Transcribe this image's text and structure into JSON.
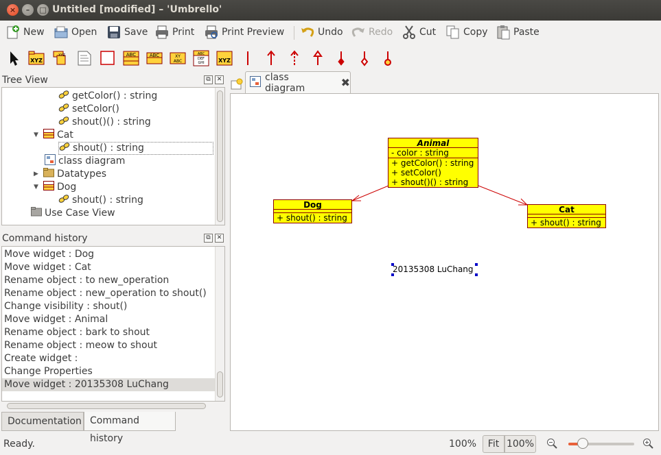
{
  "window": {
    "title": "Untitled [modified] – 'Umbrello'"
  },
  "toolbar": {
    "new": "New",
    "open": "Open",
    "save": "Save",
    "print": "Print",
    "print_preview": "Print Preview",
    "undo": "Undo",
    "redo": "Redo",
    "cut": "Cut",
    "copy": "Copy",
    "paste": "Paste"
  },
  "diagram_tools": [
    {
      "name": "select-tool-icon",
      "label": ""
    },
    {
      "name": "class-xyz-tool-icon",
      "label": "XYZ"
    },
    {
      "name": "package-tool-icon",
      "label": ""
    },
    {
      "name": "note-tool-icon",
      "label": ""
    },
    {
      "name": "box-tool-icon",
      "label": ""
    },
    {
      "name": "class-tool-icon",
      "label": "ABC"
    },
    {
      "name": "interface-tool-icon",
      "label": "ABC"
    },
    {
      "name": "datatype-tool-icon",
      "label": "XY ABC"
    },
    {
      "name": "enum-tool-icon",
      "label": "ABC DEF GHI"
    },
    {
      "name": "entity-tool-icon",
      "label": "XYZ"
    },
    {
      "name": "association-tool-icon",
      "label": ""
    },
    {
      "name": "directional-association-tool-icon",
      "label": ""
    },
    {
      "name": "dependency-tool-icon",
      "label": ""
    },
    {
      "name": "generalization-tool-icon",
      "label": ""
    },
    {
      "name": "aggregation-tool-icon",
      "label": ""
    },
    {
      "name": "composition-tool-icon",
      "label": ""
    },
    {
      "name": "containment-tool-icon",
      "label": ""
    }
  ],
  "tree_view": {
    "title": "Tree View",
    "items": [
      {
        "label": "getColor() : string",
        "type": "operation"
      },
      {
        "label": "setColor()",
        "type": "operation"
      },
      {
        "label": "shout()() : string",
        "type": "operation"
      },
      {
        "label": "Cat",
        "type": "class"
      },
      {
        "label": "shout() : string",
        "type": "operation"
      },
      {
        "label": "class diagram",
        "type": "diagram"
      },
      {
        "label": "Datatypes",
        "type": "folder"
      },
      {
        "label": "Dog",
        "type": "class"
      },
      {
        "label": "shout() : string",
        "type": "operation"
      },
      {
        "label": "Use Case View",
        "type": "folder"
      }
    ]
  },
  "command_history": {
    "title": "Command history",
    "items": [
      "Move widget : Dog",
      "Move widget : Cat",
      "Rename object :  to new_operation",
      "Rename object : new_operation to shout()",
      "Change visibility : shout()",
      "Move widget : Animal",
      "Rename object : bark to shout",
      "Rename object : meow to shout",
      "Create widget : ",
      "Change Properties",
      "Move widget : 20135308 LuChang"
    ]
  },
  "bottom_tabs": {
    "documentation": "Documentation",
    "command_history": "Command history"
  },
  "diagram_tab": {
    "label": "class diagram"
  },
  "diagram": {
    "animal": {
      "name": "Animal",
      "attributes": [
        "- color : string"
      ],
      "operations": [
        "+ getColor() : string",
        "+ setColor()",
        "+ shout()() : string"
      ]
    },
    "dog": {
      "name": "Dog",
      "operations": [
        "+ shout() : string"
      ]
    },
    "cat": {
      "name": "Cat",
      "operations": [
        "+ shout() : string"
      ]
    },
    "note": "20135308 LuChang",
    "colors": {
      "class_fill": "#ffff00",
      "class_border": "#8b0000",
      "arrow": "#cc0000",
      "handle": "#0000c8"
    }
  },
  "statusbar": {
    "status": "Ready.",
    "zoom": "100%",
    "fit": "Fit",
    "hundred": "100%",
    "zoom_level": 0.22
  }
}
